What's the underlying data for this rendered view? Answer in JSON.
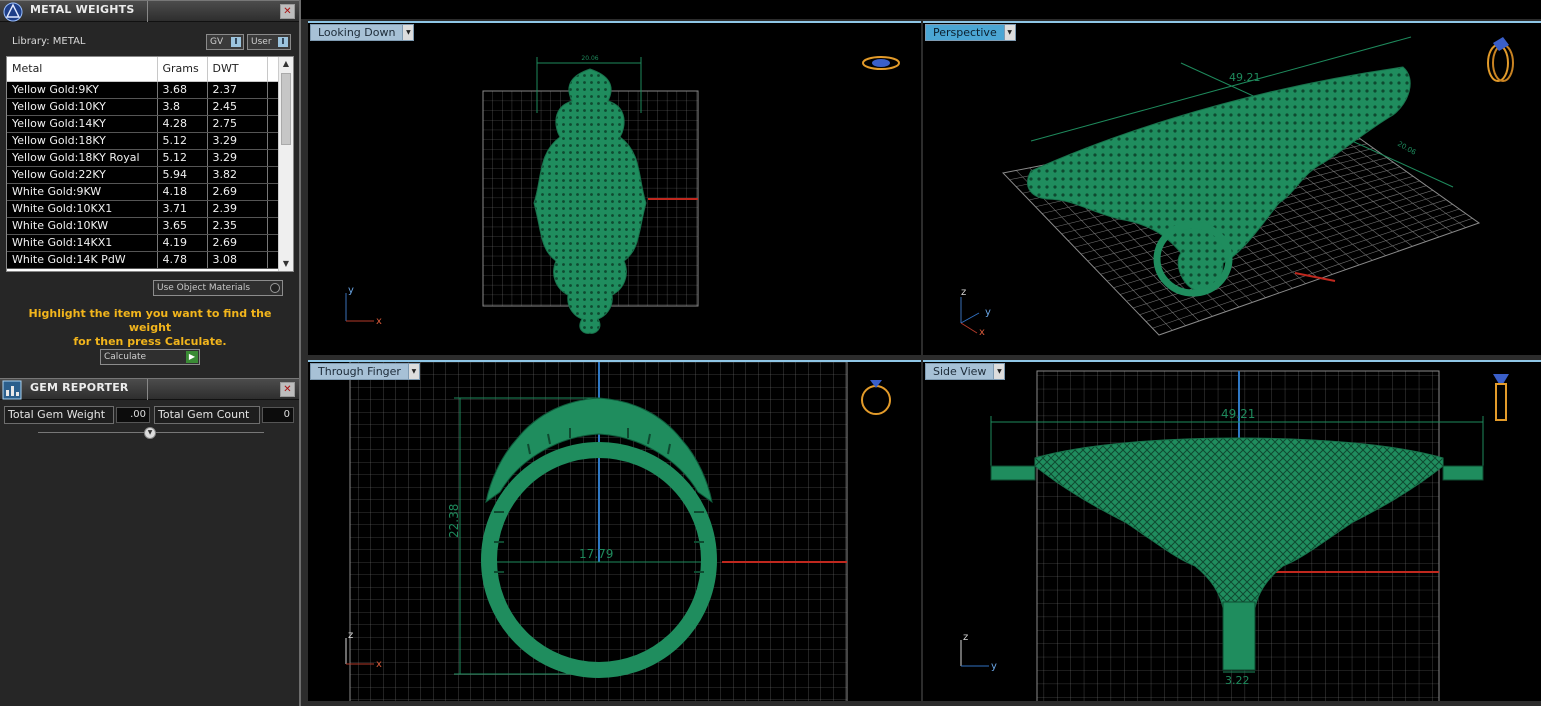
{
  "metal_panel": {
    "title": "METAL WEIGHTS",
    "library_label": "Library: METAL",
    "gv_label": "GV",
    "user_label": "User",
    "columns": [
      "Metal",
      "Grams",
      "DWT"
    ],
    "rows": [
      [
        "Yellow Gold:9KY",
        "3.68",
        "2.37"
      ],
      [
        "Yellow Gold:10KY",
        "3.8",
        "2.45"
      ],
      [
        "Yellow Gold:14KY",
        "4.28",
        "2.75"
      ],
      [
        "Yellow Gold:18KY",
        "5.12",
        "3.29"
      ],
      [
        "Yellow Gold:18KY Royal",
        "5.12",
        "3.29"
      ],
      [
        "Yellow Gold:22KY",
        "5.94",
        "3.82"
      ],
      [
        "White Gold:9KW",
        "4.18",
        "2.69"
      ],
      [
        "White Gold:10KX1",
        "3.71",
        "2.39"
      ],
      [
        "White Gold:10KW",
        "3.65",
        "2.35"
      ],
      [
        "White Gold:14KX1",
        "4.19",
        "2.69"
      ],
      [
        "White Gold:14K PdW",
        "4.78",
        "3.08"
      ]
    ],
    "use_object_materials": "Use Object Materials",
    "hint_line1": "Highlight the item you want to find the weight",
    "hint_line2": "for then press Calculate.",
    "calculate_label": "Calculate"
  },
  "gem_panel": {
    "title": "GEM REPORTER",
    "total_weight_label": "Total Gem Weight",
    "total_weight_value": ".00",
    "total_count_label": "Total Gem Count",
    "total_count_value": "0"
  },
  "viewports": {
    "looking_down": {
      "label": "Looking Down",
      "dim_width": "20.06",
      "axis_a": "y",
      "axis_b": "x"
    },
    "perspective": {
      "label": "Perspective",
      "dim_length": "49.21",
      "dim_width": "20.06",
      "axis_a": "z",
      "axis_b": "y",
      "axis_c": "x"
    },
    "through_finger": {
      "label": "Through Finger",
      "dim_height": "22.38",
      "dim_diameter": "17.79",
      "axis_a": "z",
      "axis_b": "x"
    },
    "side_view": {
      "label": "Side View",
      "dim_length": "49.21",
      "dim_shank": "3.22",
      "axis_a": "z",
      "axis_b": "y"
    }
  },
  "colors": {
    "model": "#1e8a5c",
    "accent_tab": "#4ba6d4",
    "hint": "#f2b51c"
  }
}
